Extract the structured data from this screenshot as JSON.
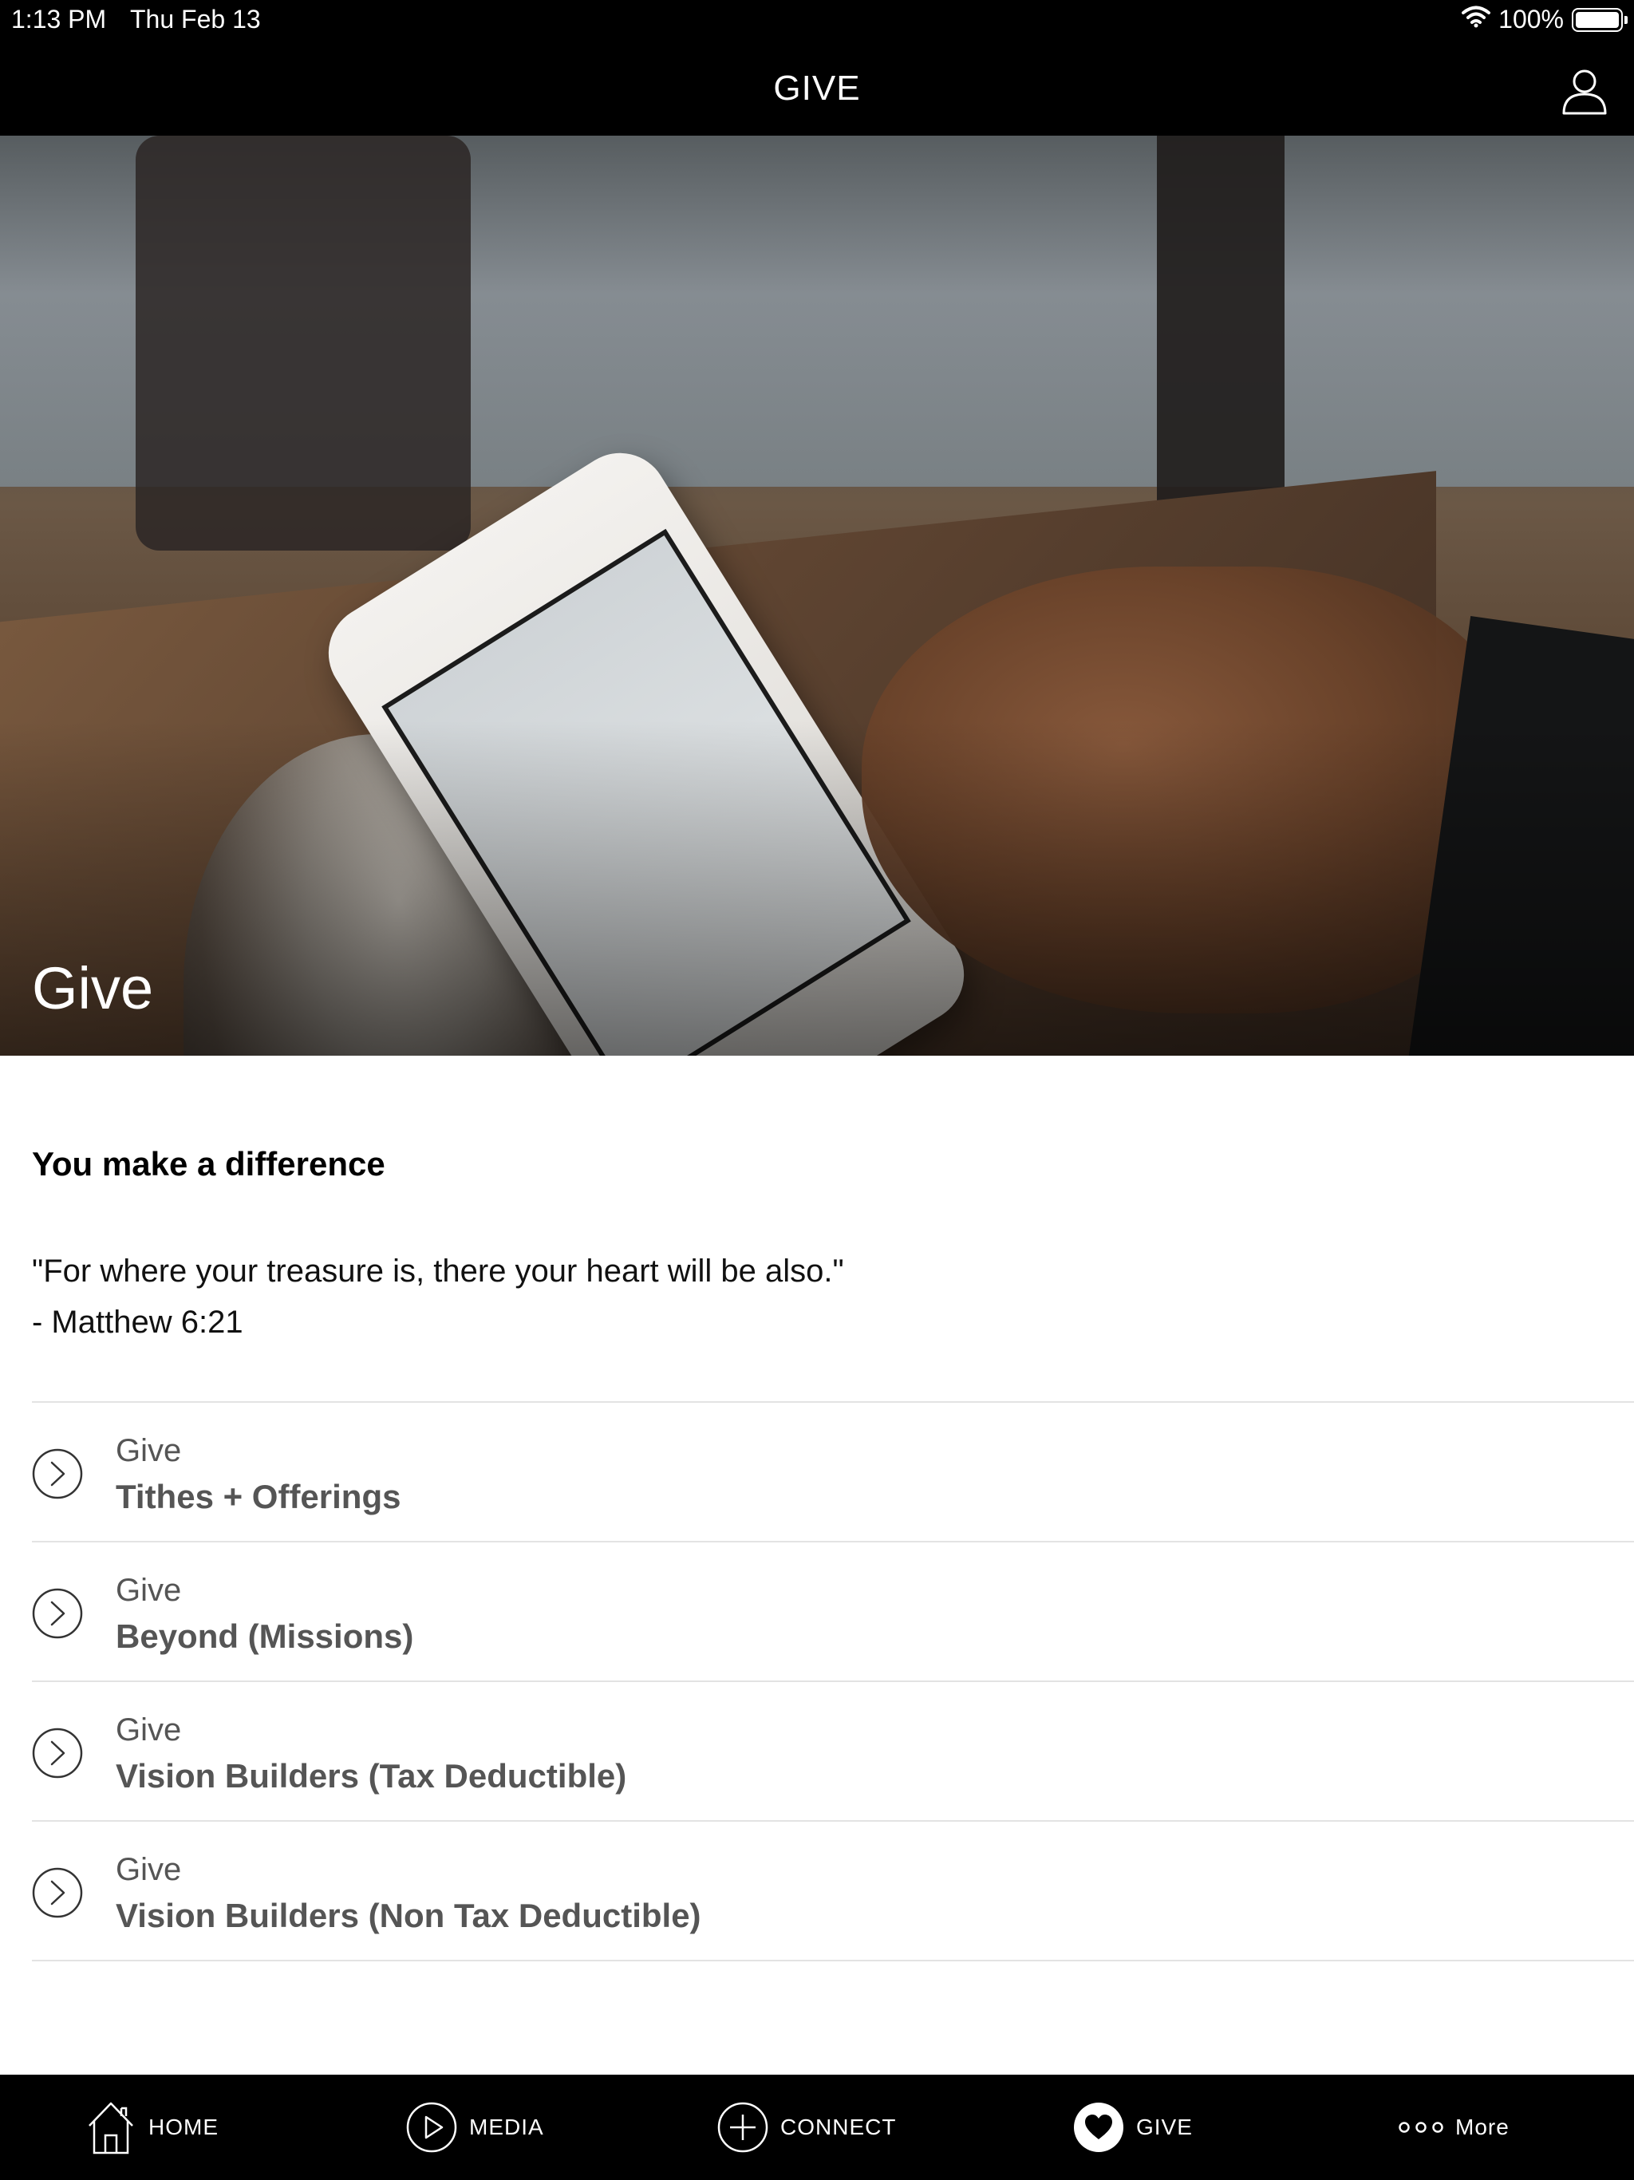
{
  "status_bar": {
    "time": "1:13 PM",
    "date": "Thu Feb 13",
    "battery": "100%"
  },
  "nav": {
    "title": "GIVE",
    "profile_icon": "person-icon"
  },
  "hero": {
    "title": "Give"
  },
  "content": {
    "subtitle": "You make a difference",
    "quote_line1": "\"For where your treasure is, there your heart will be also.\"",
    "quote_line2": "- Matthew 6:21"
  },
  "give_items": [
    {
      "top": "Give",
      "main": "Tithes + Offerings"
    },
    {
      "top": "Give",
      "main": "Beyond (Missions)"
    },
    {
      "top": "Give",
      "main": "Vision Builders (Tax Deductible)"
    },
    {
      "top": "Give",
      "main": "Vision Builders (Non Tax Deductible)"
    }
  ],
  "tabs": [
    {
      "label": "HOME",
      "icon": "home-icon"
    },
    {
      "label": "MEDIA",
      "icon": "play-icon"
    },
    {
      "label": "CONNECT",
      "icon": "plus-icon"
    },
    {
      "label": "GIVE",
      "icon": "heart-icon",
      "active": true
    },
    {
      "label": "More",
      "icon": "more-icon"
    }
  ]
}
